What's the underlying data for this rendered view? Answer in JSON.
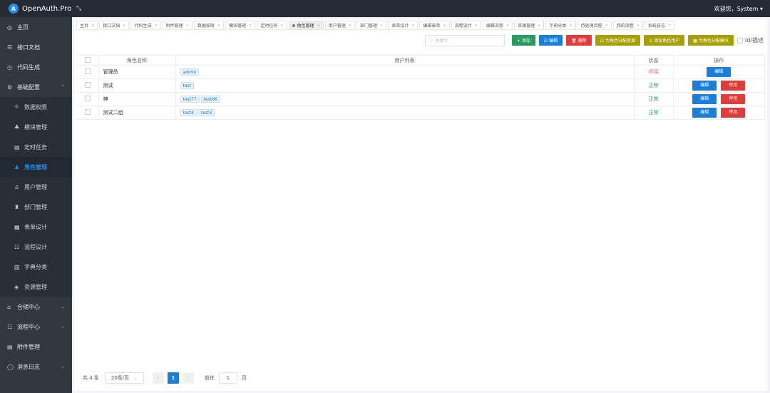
{
  "app": {
    "title": "OpenAuth.Pro",
    "collapse": "⤡",
    "welcome": "欢迎您，System ▾"
  },
  "sidebar": {
    "items": [
      {
        "label": "主页",
        "icon": "◎"
      },
      {
        "label": "接口文档",
        "icon": "☰"
      },
      {
        "label": "代码生成",
        "icon": "◷"
      },
      {
        "label": "基础配置",
        "icon": "⚙",
        "arrow": "⌃"
      }
    ],
    "subitems": [
      {
        "label": "数据权限",
        "icon": "⛗"
      },
      {
        "label": "模块管理",
        "icon": "♣"
      },
      {
        "label": "定时任务",
        "icon": "▤"
      },
      {
        "label": "角色管理",
        "icon": "♟"
      },
      {
        "label": "用户管理",
        "icon": "♙"
      },
      {
        "label": "部门管理",
        "icon": "♜"
      },
      {
        "label": "表单设计",
        "icon": "▦"
      },
      {
        "label": "流程设计",
        "icon": "☷"
      },
      {
        "label": "字典分类",
        "icon": "▥"
      },
      {
        "label": "资源管理",
        "icon": "◈"
      }
    ],
    "bottom": [
      {
        "label": "仓储中心",
        "icon": "⌂",
        "arrow": "⌄"
      },
      {
        "label": "流程中心",
        "icon": "☷",
        "arrow": "⌄"
      },
      {
        "label": "附件管理",
        "icon": "▤"
      },
      {
        "label": "消息日志",
        "icon": "◯",
        "arrow": "⌄"
      }
    ]
  },
  "tabs": [
    "主页",
    "接口文档",
    "代码生成",
    "附件管理",
    "数据权限",
    "模块管理",
    "定时任务",
    "角色管理",
    "用户管理",
    "部门管理",
    "表单设计",
    "编辑表单",
    "流程设计",
    "编辑流程",
    "资源管理",
    "字典分类",
    "待处理流程",
    "我的流程",
    "系统日志"
  ],
  "tab_close": "×",
  "toolbar": {
    "search_placeholder": "关键字",
    "search_icon": "○",
    "add": "+ 添加",
    "edit": "☑ 编辑",
    "delete": "🗑 删除",
    "assign_res": "☑ 为角色分配资源",
    "add_user": "♙ 添加角色用户",
    "assign_mod": "▦ 为角色分配模块",
    "id_desc": "Id/描述"
  },
  "table": {
    "headers": [
      "角色名称",
      "用户列表",
      "状态",
      "操作"
    ],
    "rows": [
      {
        "name": "管理员",
        "users": [
          "admin"
        ],
        "status": "停用",
        "status_type": "stop",
        "actions": [
          "编辑"
        ]
      },
      {
        "name": "测试",
        "users": [
          "test"
        ],
        "status": "正常",
        "status_type": "ok",
        "actions": [
          "编辑",
          "停用"
        ]
      },
      {
        "name": "神",
        "users": [
          "test77",
          "test66"
        ],
        "status": "正常",
        "status_type": "ok",
        "actions": [
          "编辑",
          "停用"
        ]
      },
      {
        "name": "测试二组",
        "users": [
          "test4",
          "test3"
        ],
        "status": "正常",
        "status_type": "ok",
        "actions": [
          "编辑",
          "停用"
        ]
      }
    ]
  },
  "pager": {
    "total": "共 4 条",
    "size": "20条/页",
    "size_arrow": "⌄",
    "prev": "‹",
    "current": "1",
    "next": "›",
    "goto": "前往",
    "page_input": "1",
    "page_unit": "页"
  },
  "colors": {
    "accent": "#1c7ed6",
    "green": "#299b60",
    "red": "#e03c3c",
    "olive": "#a8a000"
  }
}
